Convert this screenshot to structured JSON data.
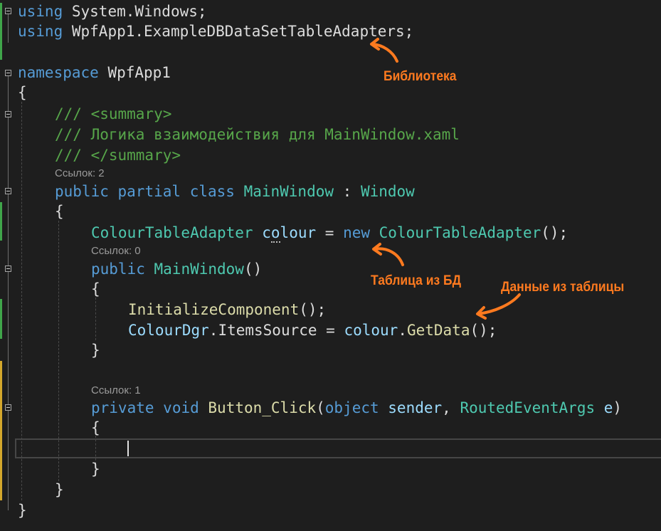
{
  "editor": {
    "usings": [
      {
        "keyword": "using",
        "name": "System.Windows",
        "semi": ";"
      },
      {
        "keyword": "using",
        "name": "WpfApp1.ExampleDBDataSetTableAdapters",
        "semi": ";"
      }
    ],
    "namespace_line": {
      "keyword": "namespace",
      "name": "WpfApp1"
    },
    "open_brace": "{",
    "close_brace": "}",
    "doc_comment": [
      "/// <summary>",
      "/// Логика взаимодействия для MainWindow.xaml",
      "/// </summary>"
    ],
    "class_refs": "Ссылок: 2",
    "class_decl": {
      "kw1": "public",
      "kw2": "partial",
      "kw3": "class",
      "name": "MainWindow",
      "colon": " : ",
      "base": "Window"
    },
    "field_decl": {
      "type": "ColourTableAdapter",
      "var_first": "c",
      "var_dotted": "o",
      "var_rest": "lour",
      "eq": " = ",
      "kw": "new",
      "ctor": "ColourTableAdapter",
      "tail": "();"
    },
    "ctor_refs": "Ссылок: 0",
    "ctor_decl": {
      "kw": "public",
      "name": "MainWindow",
      "parens": "()"
    },
    "ctor_body": [
      {
        "call": "InitializeComponent",
        "tail": "();"
      },
      {
        "obj": "ColourDgr",
        "mid": ".ItemsSource = ",
        "var": "colour",
        "dot": ".",
        "call": "GetData",
        "tail": "();"
      }
    ],
    "handler_refs": "Ссылок: 1",
    "handler_decl": {
      "kw1": "private",
      "kw2": "void",
      "name": "Button_Click",
      "open": "(",
      "p1type": "object",
      "p1name": " sender",
      "comma": ", ",
      "p2type": "RoutedEventArgs",
      "p2name": " e",
      "close": ")"
    }
  },
  "annotations": {
    "library": "Библиотека",
    "table": "Таблица из БД",
    "data": "Данные из таблицы"
  },
  "colors": {
    "background": "#1e1e1e",
    "keyword": "#569cd6",
    "type": "#4ec9b0",
    "method": "#dcdcaa",
    "identifier": "#9cdcfe",
    "comment": "#57a64a",
    "annotation": "#ff7a1f",
    "change_saved": "#3fa54a",
    "change_unsaved": "#d4a72c"
  },
  "icons": [
    "collapse-icon",
    "annotation-arrow"
  ]
}
